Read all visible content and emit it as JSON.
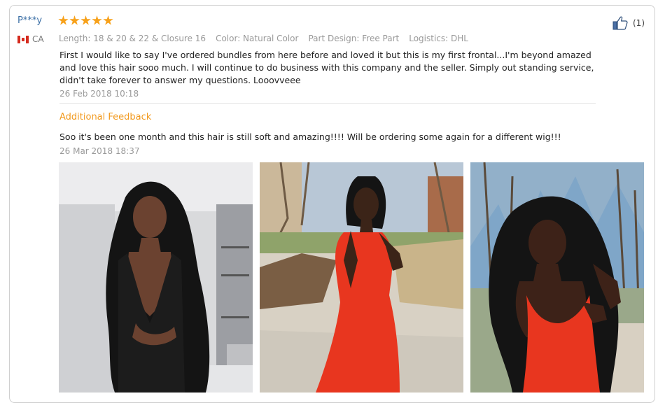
{
  "review": {
    "user_name": "P***y",
    "country": "CA",
    "rating": 5,
    "meta": {
      "length": "Length: 18 & 20 & 22 & Closure 16",
      "color": "Color: Natural Color",
      "part_design": "Part Design: Free Part",
      "logistics": "Logistics: DHL"
    },
    "text": "First I would like to say I've ordered bundles from here before and loved it but this is my first frontal...I'm beyond amazed and love this hair sooo much. I will continue to do business with this company and the seller. Simply out standing service, didn't take forever to answer my questions. Looovveee",
    "date": "26 Feb 2018 10:18",
    "helpful_count": "(1)",
    "additional": {
      "title": "Additional Feedback",
      "text": "Soo it's been one month and this hair is still soft and amazing!!!! Will be ordering some again for a different wig!!!",
      "date": "26 Mar 2018 18:37"
    }
  },
  "icons": {
    "thumbs_up": "thumbs-up-icon",
    "star": "star-icon",
    "flag": "canada-flag-icon"
  },
  "colors": {
    "star": "#f7a11a",
    "user_name": "#3a6ea5",
    "additional_title": "#f29a1f",
    "dress_red": "#e8361f"
  }
}
